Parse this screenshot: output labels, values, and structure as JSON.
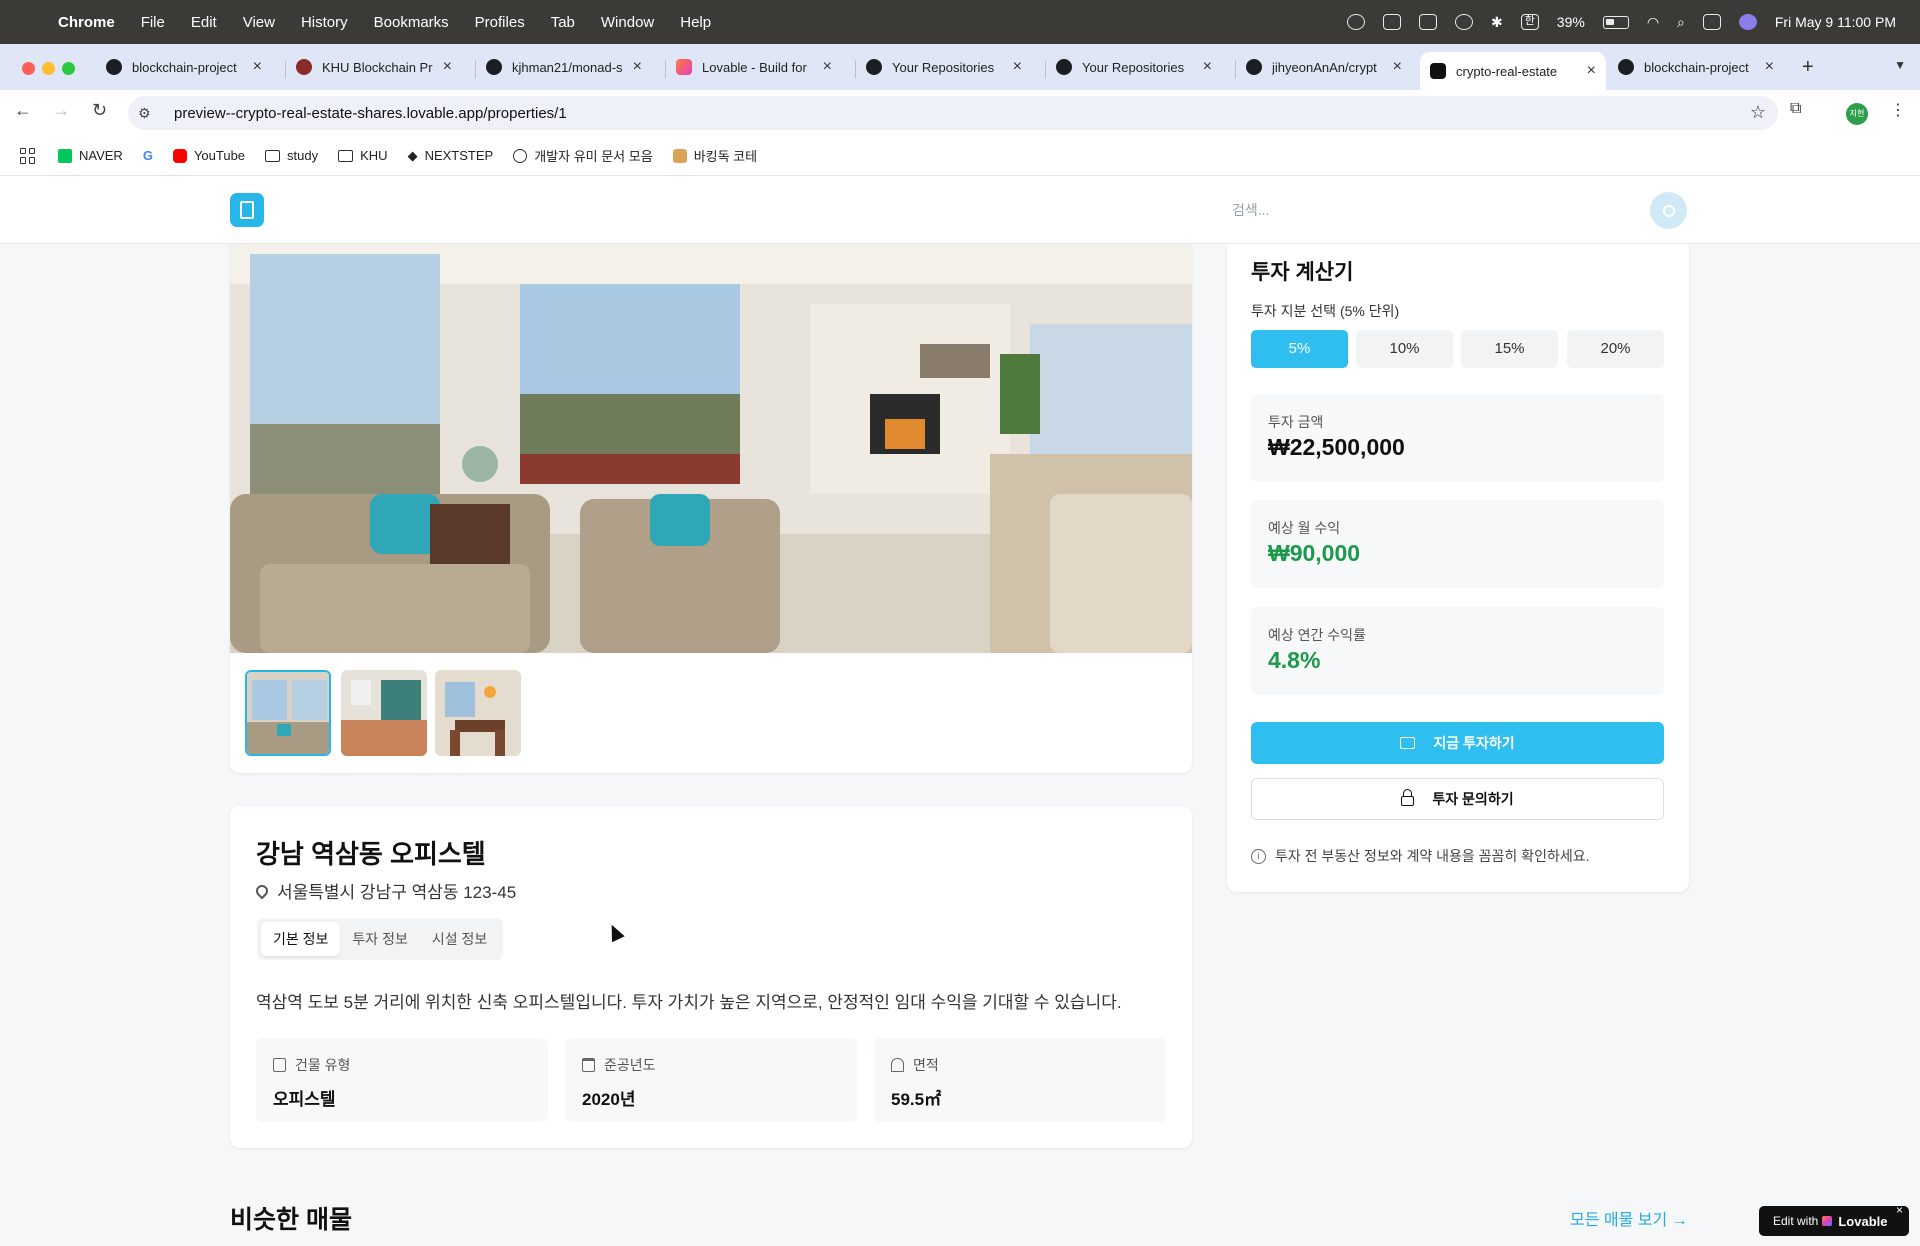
{
  "menubar": {
    "app": "Chrome",
    "items": [
      "File",
      "Edit",
      "View",
      "History",
      "Bookmarks",
      "Profiles",
      "Tab",
      "Window",
      "Help"
    ],
    "battery": "39%",
    "ime": "한",
    "datetime": "Fri May 9  11:00 PM"
  },
  "tabs": [
    {
      "title": "blockchain-project",
      "icon": "github-icon"
    },
    {
      "title": "KHU Blockchain Pr",
      "icon": "khu-icon"
    },
    {
      "title": "kjhman21/monad-s",
      "icon": "github-icon"
    },
    {
      "title": "Lovable - Build for",
      "icon": "lovable-icon"
    },
    {
      "title": "Your Repositories",
      "icon": "github-icon"
    },
    {
      "title": "Your Repositories",
      "icon": "github-icon"
    },
    {
      "title": "jihyeonAnAn/crypt",
      "icon": "github-icon"
    },
    {
      "title": "crypto-real-estate",
      "icon": "heart-icon",
      "active": true
    },
    {
      "title": "blockchain-project",
      "icon": "github-icon"
    }
  ],
  "toolbar": {
    "url": "preview--crypto-real-estate-shares.lovable.app/properties/1",
    "profile_initials": "지현"
  },
  "bookmarks": [
    "NAVER",
    "YouTube",
    "study",
    "KHU",
    "NEXTSTEP",
    "개발자 유미 문서 모음",
    "바킹독 코테"
  ],
  "site": {
    "search_placeholder": "검색..."
  },
  "property": {
    "title": "강남 역삼동 오피스텔",
    "address": "서울특별시 강남구 역삼동 123-45",
    "tabs": [
      "기본 정보",
      "투자 정보",
      "시설 정보"
    ],
    "description": "역삼역 도보 5분 거리에 위치한 신축 오피스텔입니다. 투자 가치가 높은 지역으로, 안정적인 임대 수익을 기대할 수 있습니다.",
    "stats": [
      {
        "label": "건물 유형",
        "value": "오피스텔",
        "icon": "building-icon"
      },
      {
        "label": "준공년도",
        "value": "2020년",
        "icon": "calendar-icon"
      },
      {
        "label": "면적",
        "value": "59.5㎡",
        "icon": "home-icon"
      }
    ]
  },
  "calculator": {
    "title": "투자 계산기",
    "share_label": "투자 지분 선택 (5% 단위)",
    "options": [
      "5%",
      "10%",
      "15%",
      "20%"
    ],
    "selected": "5%",
    "amount_label": "투자 금액",
    "amount": "₩22,500,000",
    "monthly_label": "예상 월 수익",
    "monthly": "₩90,000",
    "yield_label": "예상 연간 수익률",
    "yield": "4.8%",
    "invest_button": "지금 투자하기",
    "inquiry_button": "투자 문의하기",
    "notice": "투자 전 부동산 정보와 계약 내용을 꼼꼼히 확인하세요."
  },
  "similar": {
    "title": "비슷한 매물",
    "see_all": "모든 매물 보기 →"
  },
  "badge": {
    "edit_with": "Edit with",
    "brand": "Lovable"
  },
  "colors": {
    "accent": "#2fbef0",
    "positive": "#1a9a4a"
  }
}
